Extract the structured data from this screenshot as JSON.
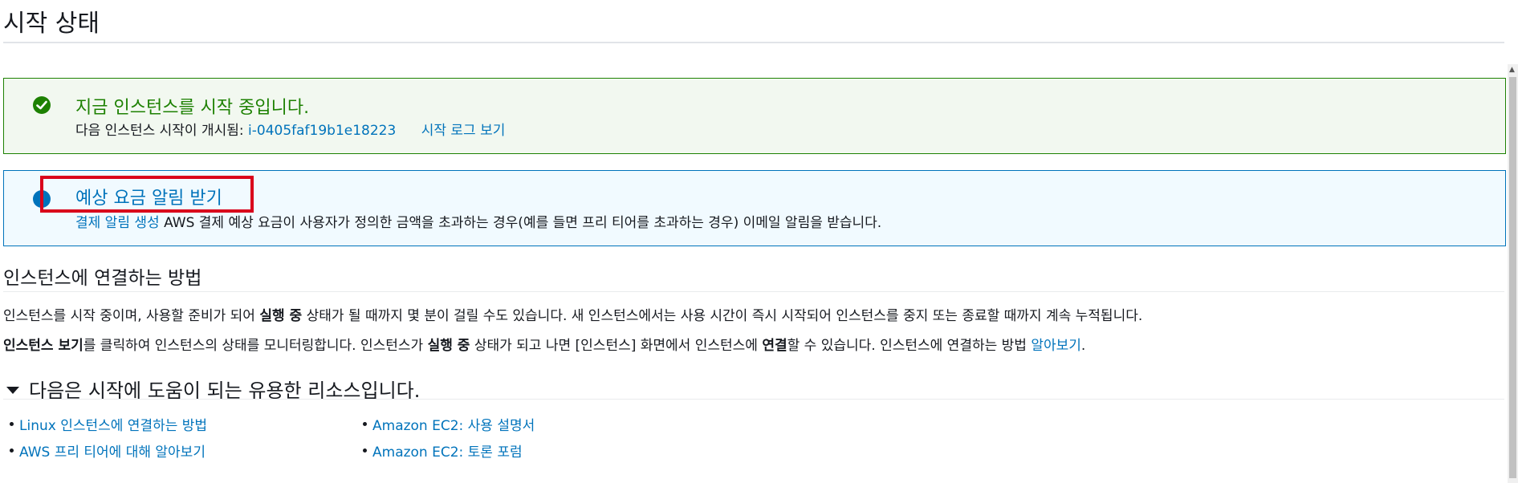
{
  "page": {
    "title": "시작 상태"
  },
  "success_alert": {
    "heading": "지금 인스턴스를 시작 중입니다.",
    "body_prefix": "다음 인스턴스 시작이 개시됨:",
    "instance_id": "i-0405faf19b1e18223",
    "log_link": "시작 로그 보기"
  },
  "info_alert": {
    "heading": "예상 요금 알림 받기",
    "link": "결제 알림 생성",
    "body": "AWS 결제 예상 요금이 사용자가 정의한 금액을 초과하는 경우(예를 들면 프리 티어를 초과하는 경우) 이메일 알림을 받습니다."
  },
  "connect": {
    "heading": "인스턴스에 연결하는 방법",
    "p1_a": "인스턴스를 시작 중이며, 사용할 준비가 되어 ",
    "p1_bold": "실행 중",
    "p1_b": " 상태가 될 때까지 몇 분이 걸릴 수도 있습니다. 새 인스턴스에서는 사용 시간이 즉시 시작되어 인스턴스를 중지 또는 종료할 때까지 계속 누적됩니다.",
    "p2_bold1": "인스턴스 보기",
    "p2_a": "를 클릭하여 인스턴스의 상태를 모니터링합니다. 인스턴스가 ",
    "p2_bold2": "실행 중",
    "p2_b": " 상태가 되고 나면 [인스턴스] 화면에서 인스턴스에 ",
    "p2_bold3": "연결",
    "p2_c": "할 수 있습니다. 인스턴스에 연결하는 방법 ",
    "p2_link": "알아보기",
    "p2_end": "."
  },
  "resources": {
    "heading": "다음은 시작에 도움이 되는 유용한 리소스입니다.",
    "left": [
      {
        "label": "Linux 인스턴스에 연결하는 방법"
      },
      {
        "label": "AWS 프리 티어에 대해 알아보기"
      }
    ],
    "right": [
      {
        "label": "Amazon EC2: 사용 설명서"
      },
      {
        "label": "Amazon EC2: 토론 포럼"
      }
    ]
  },
  "icons": {
    "success": "check-circle-icon",
    "info": "info-circle-icon",
    "caret": "caret-down-icon"
  },
  "colors": {
    "success": "#1d8102",
    "info": "#0073bb",
    "link": "#0073bb",
    "highlight": "#d9001b"
  }
}
